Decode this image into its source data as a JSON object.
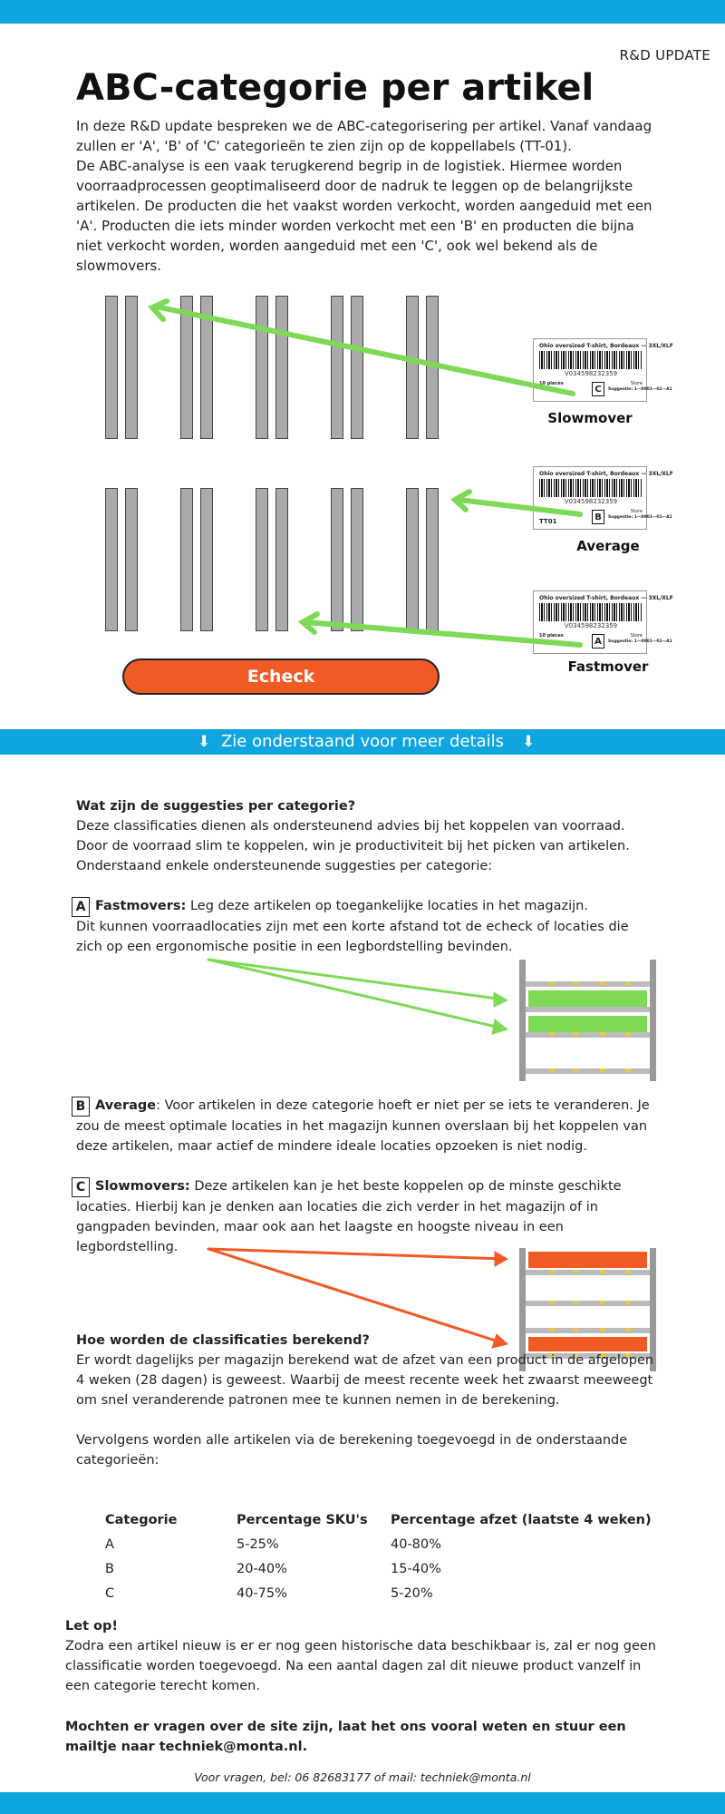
{
  "header": {
    "tag": "R&D UPDATE",
    "title": "ABC-categorie per artikel",
    "intro": [
      "In deze R&D update bespreken we de ABC-categorisering per artikel. Vanaf vandaag zullen er 'A', 'B' of 'C' categorieën te zien zijn op de koppellabels (TT-01).",
      "De ABC-analyse is een vaak terugkerend begrip in de logistiek. Hiermee worden voorraadprocessen geoptimaliseerd door de nadruk te leggen op de belangrijkste artikelen. De producten die het vaakst worden verkocht, worden aangeduid met een 'A'. Producten die iets minder worden verkocht met een 'B' en producten die bijna niet verkocht worden, worden aangeduid met een 'C', ook wel bekend als de slowmovers."
    ]
  },
  "labels": {
    "product": "Ohio oversized T-shirt, Bordeaux — 3XL/XLF",
    "barcode_number": "V034598232359",
    "qty": "10 pieces",
    "storage": "Store",
    "suggestie": "Suggestie: 1—0001—01—A1",
    "tt01": "TT01",
    "slowmover": {
      "letter": "C",
      "caption": "Slowmover"
    },
    "average": {
      "letter": "B",
      "caption": "Average"
    },
    "fastmover": {
      "letter": "A",
      "caption": "Fastmover"
    }
  },
  "echeck_label": "Echeck",
  "details_bar": {
    "arrow_left": "⬇",
    "text": "Zie onderstaand voor meer details",
    "arrow_right": "⬇"
  },
  "suggestions": {
    "heading": "Wat zijn de suggesties per categorie?",
    "body": "Deze classificaties dienen als ondersteunend advies bij het koppelen van voorraad. Door de voorraad slim te koppelen, win je productiviteit bij het picken van artikelen. Onderstaand enkele ondersteunende suggesties per categorie:",
    "a": {
      "letter": "A",
      "name": "Fastmovers:",
      "text": " Leg deze artikelen op toegankelijke locaties in het magazijn.",
      "text2": "Dit kunnen voorraadlocaties zijn met een korte afstand tot de echeck of locaties die zich op een ergonomische positie in een legbordstelling bevinden."
    },
    "b": {
      "letter": "B",
      "name": "Average",
      "text": ": Voor artikelen in deze categorie hoeft er niet per se iets te veranderen. Je zou de meest optimale locaties in het magazijn kunnen overslaan bij het koppelen van deze artikelen, maar actief de mindere ideale locaties opzoeken is niet nodig."
    },
    "c": {
      "letter": "C",
      "name": "Slowmovers:",
      "text": " Deze artikelen kan je het beste koppelen op de minste geschikte locaties. Hierbij kan je denken aan locaties die zich verder in het magazijn of in gangpaden bevinden, maar ook aan het laagste en hoogste niveau in een legbordstelling."
    }
  },
  "calculation": {
    "heading": "Hoe worden de classificaties berekend?",
    "body": "Er wordt dagelijks per magazijn berekend wat de afzet van een product in de afgelopen 4 weken (28 dagen) is geweest. Waarbij de meest recente week het zwaarst meeweegt om snel veranderende patronen mee te kunnen nemen in de berekening.",
    "body2": "Vervolgens worden alle artikelen via de berekening toegevoegd in de onderstaande categorieën:",
    "table": {
      "headers": [
        "Categorie",
        "Percentage SKU's",
        "Percentage afzet (laatste 4 weken)"
      ],
      "rows": [
        [
          "A",
          "5-25%",
          "40-80%"
        ],
        [
          "B",
          "20-40%",
          "15-40%"
        ],
        [
          "C",
          "40-75%",
          "5-20%"
        ]
      ]
    }
  },
  "note": {
    "heading": "Let op!",
    "body": "Zodra een artikel nieuw is er er nog geen historische data beschikbaar is, zal er nog geen classificatie worden toegevoegd. Na een aantal dagen zal dit nieuwe product vanzelf in een categorie terecht komen."
  },
  "closing": "Mochten er vragen over de site zijn, laat het ons vooral weten en stuur een mailtje naar techniek@monta.nl.",
  "footer_contact": "Voor vragen, bel: 06 82683177 of mail: techniek@monta.nl",
  "colors": {
    "brand_blue": "#0ea5e0",
    "accent_orange": "#f05a24",
    "green": "#7ed957"
  }
}
